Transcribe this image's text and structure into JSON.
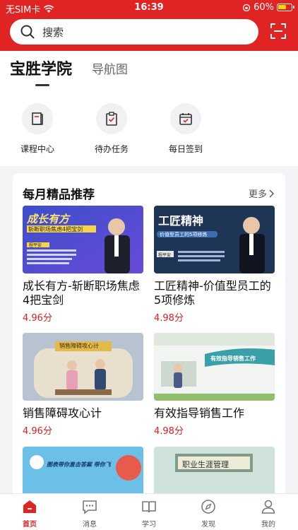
{
  "status_bar": {
    "carrier": "无SIM卡",
    "time": "16:39",
    "battery": "60%"
  },
  "search": {
    "placeholder": "搜索"
  },
  "tabs": {
    "active": "宝胜学院",
    "other": "导航图"
  },
  "quick_actions": [
    {
      "label": "课程中心",
      "icon": "book-icon"
    },
    {
      "label": "待办任务",
      "icon": "clipboard-check-icon"
    },
    {
      "label": "每日签到",
      "icon": "calendar-check-icon"
    }
  ],
  "recommend": {
    "title": "每月精品推荐",
    "more": "更多",
    "courses": [
      {
        "title": "成长有方-斩断职场焦虑4把宝剑",
        "score": "4.96分",
        "thumb_text": "成长有方",
        "thumb_sub": "斩断职场焦虑4把宝剑",
        "thumb_name": "程平安"
      },
      {
        "title": "工匠精神-价值型员工的5项修炼",
        "score": "4.98分",
        "thumb_text": "工匠精神",
        "thumb_sub": "价值型员工的5项修炼",
        "thumb_name": "程平安"
      },
      {
        "title": "销售障碍攻心计",
        "score": "4.96分",
        "thumb_text": "销售障碍攻心计"
      },
      {
        "title": "有效指导销售工作",
        "score": "4.98分",
        "thumb_text": "有效指导销售工作"
      },
      {
        "title": "",
        "score": "",
        "thumb_text": "图表带你直击答案 带你飞"
      },
      {
        "title": "",
        "score": "",
        "thumb_text": "职业生涯管理"
      }
    ]
  },
  "tabbar": [
    {
      "label": "首页",
      "icon": "home-icon",
      "active": true
    },
    {
      "label": "消息",
      "icon": "message-icon",
      "active": false
    },
    {
      "label": "学习",
      "icon": "book-open-icon",
      "active": false
    },
    {
      "label": "发现",
      "icon": "compass-icon",
      "active": false
    },
    {
      "label": "我的",
      "icon": "user-icon",
      "active": false
    }
  ],
  "colors": {
    "brand_red": "#e02323",
    "score_red": "#d32222"
  }
}
